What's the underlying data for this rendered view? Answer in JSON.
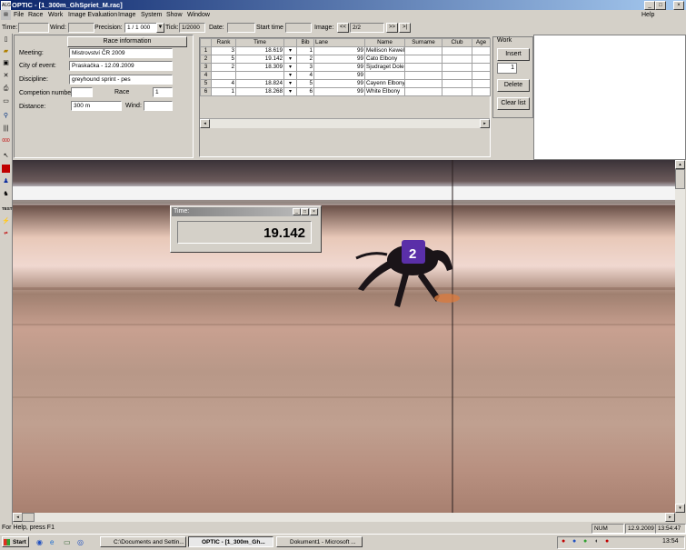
{
  "window": {
    "title": "OPTIC - [1_300m_GhSpriet_M.rac]",
    "logo": "ALG"
  },
  "menu": [
    "File",
    "Race",
    "Work",
    "Image Evaluation",
    "Image",
    "System",
    "Show",
    "Window"
  ],
  "menu_help": "Help",
  "toolbar": {
    "time_label": "Time:",
    "time_value": "",
    "wind_label": "Wind:",
    "wind_value": "",
    "precision_label": "Precision:",
    "precision_value": "1 / 1 000",
    "tick_label": "Tick:",
    "tick_value": "1/2000",
    "date_label": "Date:",
    "date_value": "",
    "start_label": "Start time",
    "start_value": "",
    "image_label": "Image:",
    "image_value": "2/2",
    "prev": "<<",
    "next": ">>",
    "last": ">|"
  },
  "race_info": {
    "header": "Race information",
    "meeting_label": "Meeting:",
    "meeting": "Mistrovství ČR 2009",
    "city_label": "City of event:",
    "city": "Praskačka - 12.09.2009",
    "discipline_label": "Discipline:",
    "discipline": "greyhound sprint - pes",
    "competition_label": "Competion number:",
    "competition": "",
    "race_label": "Race",
    "race": "1",
    "distance_label": "Distance:",
    "distance": "300 m",
    "wind_label": "Wind:",
    "wind": ""
  },
  "results": {
    "columns": [
      "Rank",
      "Time",
      "Bib",
      "Lane",
      "Name",
      "Surname",
      "Club",
      "Age"
    ],
    "rows": [
      {
        "no": "1",
        "rank": "3",
        "time": "18.619",
        "bib": "1",
        "lane": "99",
        "name": "Mellison Kewell"
      },
      {
        "no": "2",
        "rank": "5",
        "time": "19.142",
        "bib": "2",
        "lane": "99",
        "name": "Cato Elbony"
      },
      {
        "no": "3",
        "rank": "2",
        "time": "18.309",
        "bib": "3",
        "lane": "99",
        "name": "Sjudraget Dole"
      },
      {
        "no": "4",
        "rank": "",
        "time": "",
        "bib": "4",
        "lane": "99",
        "name": ""
      },
      {
        "no": "5",
        "rank": "4",
        "time": "18.824",
        "bib": "5",
        "lane": "99",
        "name": "Cayenn Elbony"
      },
      {
        "no": "6",
        "rank": "1",
        "time": "18.268",
        "bib": "6",
        "lane": "99",
        "name": "White Elbony"
      }
    ]
  },
  "work": {
    "title": "Work",
    "insert": "Insert",
    "spinner": "1",
    "delete": "Delete",
    "clear": "Clear list"
  },
  "time_popup": {
    "title": "Time:",
    "value": "19.142"
  },
  "dog_bib": "2",
  "status": {
    "help": "For Help, press F1",
    "num": "NUM",
    "date": "12.9.2009",
    "time": "13:54:47"
  },
  "taskbar": {
    "start": "Start",
    "items": [
      "C:\\Documents and Settin...",
      "OPTIC - [1_300m_Gh...",
      "Dokument1 - Microsoft ..."
    ],
    "clock": "13:54"
  },
  "colors": {
    "titlebar": "#0a246a",
    "chrome": "#d4d0c8",
    "dog_jersey": "#5a2fa8"
  }
}
